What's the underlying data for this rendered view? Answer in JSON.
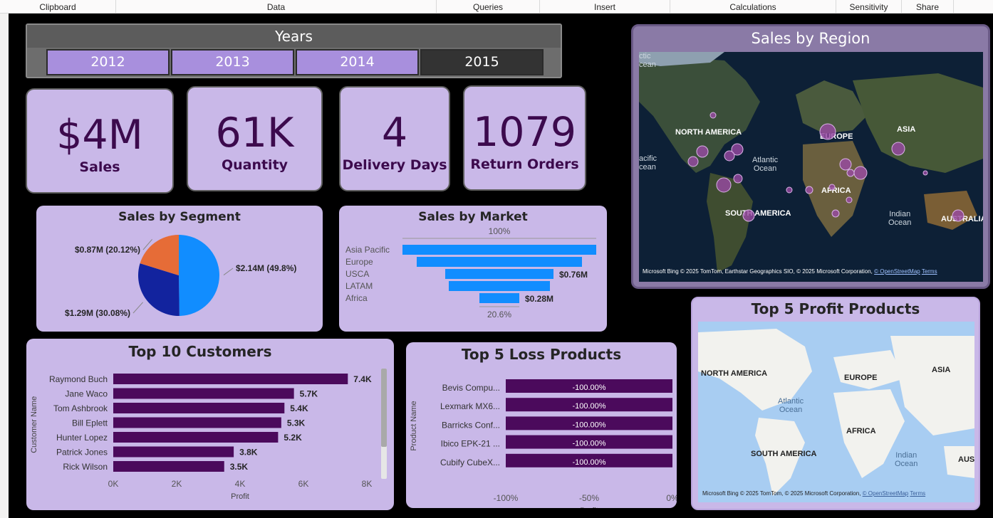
{
  "ribbon": [
    "Clipboard",
    "Data",
    "Queries",
    "Insert",
    "Calculations",
    "Sensitivity",
    "Share"
  ],
  "years": {
    "title": "Years",
    "items": [
      "2012",
      "2013",
      "2014",
      "2015"
    ],
    "selected": "2015"
  },
  "kpis": [
    {
      "value": "$4M",
      "label": "Sales"
    },
    {
      "value": "61K",
      "label": "Quantity"
    },
    {
      "value": "4",
      "label": "Delivery Days"
    },
    {
      "value": "1079",
      "label": "Return Orders"
    }
  ],
  "region_map": {
    "title": "Sales by Region",
    "labels": [
      "NORTH AMERICA",
      "EUROPE",
      "ASIA",
      "AFRICA",
      "SOUTH AMERICA",
      "AUSTRALIA"
    ],
    "oceans": [
      "Atlantic\nOcean",
      "Indian\nOcean",
      "acific\ncean",
      "ctic\ncean"
    ],
    "attribution": "© 2025 TomTom, Earthstar Geographics SIO, © 2025 Microsoft Corporation,",
    "osm": "© OpenStreetMap",
    "terms": "Terms",
    "brand": "Microsoft Bing"
  },
  "profit_map": {
    "title": "Top 5 Profit Products",
    "labels": [
      "NORTH AMERICA",
      "EUROPE",
      "ASIA",
      "AFRICA",
      "SOUTH AMERICA",
      "AUST"
    ],
    "oceans": [
      "Atlantic\nOcean",
      "Indian\nOcean"
    ],
    "attribution": "© 2025 TomTom, © 2025 Microsoft Corporation,",
    "osm": "© OpenStreetMap",
    "terms": "Terms",
    "brand": "Microsoft Bing"
  },
  "colors": {
    "purple_card": "#c9b8e8",
    "dark_purple": "#4b0a5c",
    "blue": "#118dff",
    "navy": "#12239e",
    "orange": "#e66c37"
  },
  "chart_data": [
    {
      "type": "pie",
      "title": "Sales by Segment",
      "slices": [
        {
          "value": 2.14,
          "pct": 49.8,
          "label": "$2.14M (49.8%)",
          "color": "#118dff"
        },
        {
          "value": 1.29,
          "pct": 30.08,
          "label": "$1.29M (30.08%)",
          "color": "#12239e"
        },
        {
          "value": 0.87,
          "pct": 20.12,
          "label": "$0.87M (20.12%)",
          "color": "#e66c37"
        }
      ]
    },
    {
      "type": "bar",
      "subtype": "funnel",
      "title": "Sales by Market",
      "categories": [
        "Asia Pacific",
        "Europe",
        "USCA",
        "LATAM",
        "Africa"
      ],
      "values": [
        1.36,
        1.16,
        0.76,
        0.71,
        0.28
      ],
      "data_labels": [
        "",
        "",
        "$0.76M",
        "",
        "$0.28M"
      ],
      "top_label": "100%",
      "bottom_label": "20.6%"
    },
    {
      "type": "bar",
      "orientation": "horizontal",
      "title": "Top 10 Customers",
      "ylabel": "Customer Name",
      "xlabel": "Profit",
      "categories": [
        "Raymond Buch",
        "Jane Waco",
        "Tom Ashbrook",
        "Bill Eplett",
        "Hunter Lopez",
        "Patrick Jones",
        "Rick Wilson"
      ],
      "values": [
        7400,
        5700,
        5400,
        5300,
        5200,
        3800,
        3500
      ],
      "data_labels": [
        "7.4K",
        "5.7K",
        "5.4K",
        "5.3K",
        "5.2K",
        "3.8K",
        "3.5K"
      ],
      "xticks": [
        "0K",
        "2K",
        "4K",
        "6K",
        "8K"
      ],
      "xlim": [
        0,
        8000
      ]
    },
    {
      "type": "bar",
      "orientation": "horizontal",
      "title": "Top 5 Loss Products",
      "ylabel": "Product Name",
      "xlabel": "Profit",
      "categories": [
        "Bevis Compu...",
        "Lexmark MX6...",
        "Barricks Conf...",
        "Ibico EPK-21 ...",
        "Cubify CubeX..."
      ],
      "values": [
        -100,
        -100,
        -100,
        -100,
        -100
      ],
      "data_labels": [
        "-100.00%",
        "-100.00%",
        "-100.00%",
        "-100.00%",
        "-100.00%"
      ],
      "xticks": [
        "-100%",
        "-50%",
        "0%"
      ],
      "xlim": [
        -100,
        0
      ]
    }
  ]
}
